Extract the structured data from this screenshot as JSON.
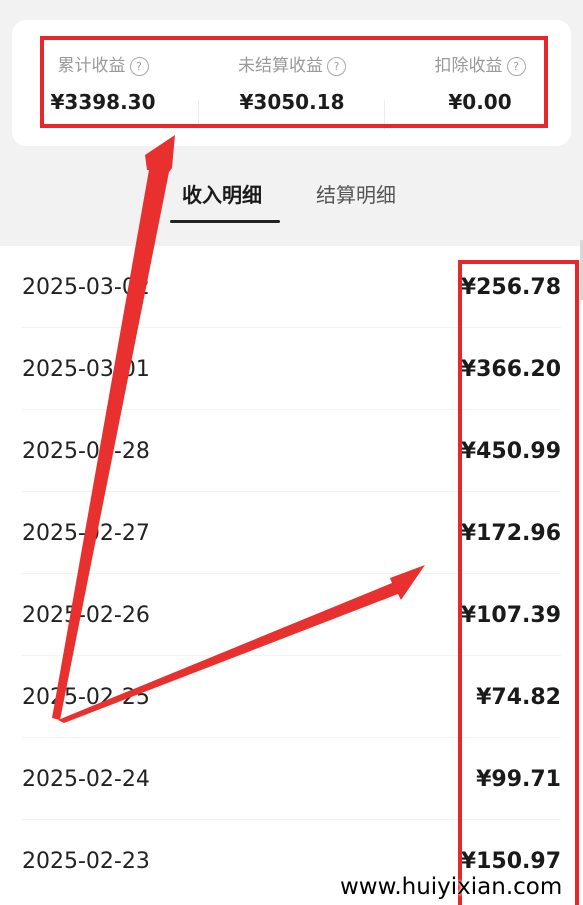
{
  "summary": {
    "total_income": {
      "label": "累计收益",
      "value": "¥3398.30"
    },
    "unsettled_income": {
      "label": "未结算收益",
      "value": "¥3050.18"
    },
    "deductions": {
      "label": "扣除收益",
      "value": "¥0.00"
    },
    "help_glyph": "?"
  },
  "tabs": [
    {
      "label": "收入明细",
      "active": true
    },
    {
      "label": "结算明细",
      "active": false
    }
  ],
  "records": [
    {
      "date": "2025-03-02",
      "amount": "¥256.78"
    },
    {
      "date": "2025-03-01",
      "amount": "¥366.20"
    },
    {
      "date": "2025-02-28",
      "amount": "¥450.99"
    },
    {
      "date": "2025-02-27",
      "amount": "¥172.96"
    },
    {
      "date": "2025-02-26",
      "amount": "¥107.39"
    },
    {
      "date": "2025-02-25",
      "amount": "¥74.82"
    },
    {
      "date": "2025-02-24",
      "amount": "¥99.71"
    },
    {
      "date": "2025-02-23",
      "amount": "¥150.97"
    }
  ],
  "annotations": {
    "highlight_color": "#e8262b",
    "arrow_color": "#e8302e"
  },
  "watermark": "www.huiyixian.com"
}
